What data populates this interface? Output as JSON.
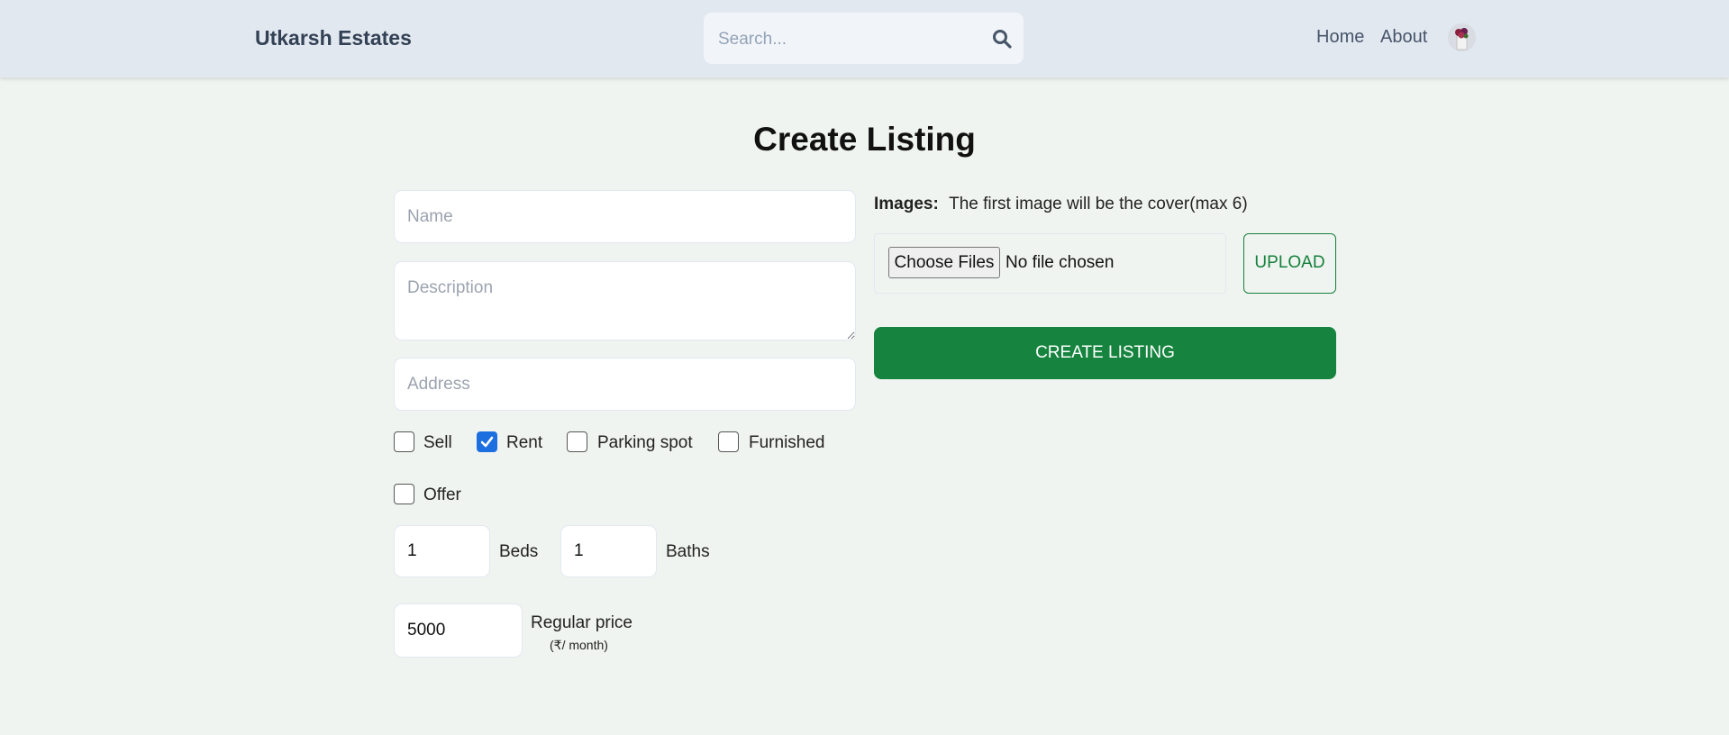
{
  "header": {
    "brand": "Utkarsh Estates",
    "search_placeholder": "Search...",
    "nav": {
      "home": "Home",
      "about": "About"
    }
  },
  "page_title": "Create Listing",
  "form": {
    "name_placeholder": "Name",
    "description_placeholder": "Description",
    "address_placeholder": "Address",
    "checkboxes": {
      "sell": {
        "label": "Sell",
        "checked": false
      },
      "rent": {
        "label": "Rent",
        "checked": true
      },
      "parking": {
        "label": "Parking spot",
        "checked": false
      },
      "furnished": {
        "label": "Furnished",
        "checked": false
      },
      "offer": {
        "label": "Offer",
        "checked": false
      }
    },
    "beds": {
      "value": "1",
      "label": "Beds"
    },
    "baths": {
      "value": "1",
      "label": "Baths"
    },
    "regular_price": {
      "value": "5000",
      "label": "Regular price",
      "unit": "(₹/ month)"
    }
  },
  "images": {
    "label": "Images:",
    "note": "The first image will be the cover(max 6)",
    "choose_files": "Choose Files",
    "no_file": "No file chosen",
    "upload": "UPLOAD"
  },
  "submit": "CREATE LISTING",
  "colors": {
    "header_bg": "#e2e8f0",
    "page_bg": "#f0f4f0",
    "accent_green": "#16843f",
    "checkbox_blue": "#1d6fe0"
  }
}
